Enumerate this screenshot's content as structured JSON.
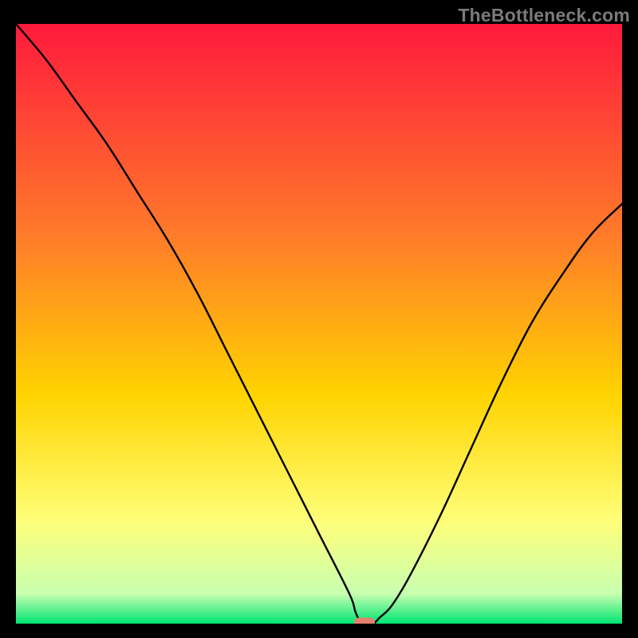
{
  "watermark": "TheBottleneck.com",
  "chart_data": {
    "type": "line",
    "title": "",
    "xlabel": "",
    "ylabel": "",
    "xlim": [
      0,
      100
    ],
    "ylim": [
      0,
      100
    ],
    "x": [
      0,
      5,
      10,
      15,
      20,
      25,
      30,
      35,
      40,
      45,
      50,
      55,
      56,
      57,
      58,
      59,
      60,
      62,
      65,
      70,
      75,
      80,
      85,
      90,
      95,
      100
    ],
    "y": [
      100,
      94,
      87,
      80,
      72,
      64,
      55,
      45,
      35,
      25,
      15,
      5,
      2,
      0,
      0,
      0,
      1,
      3,
      8,
      18,
      29,
      40,
      50,
      58,
      65,
      70
    ],
    "flat_region": {
      "x_start": 55,
      "x_end": 59,
      "y": 0
    },
    "marker": {
      "x": 57.5,
      "y": 0
    }
  },
  "colors": {
    "gradient_top": "#ff1a3c",
    "gradient_mid1": "#ff7a2a",
    "gradient_mid2": "#ffd400",
    "gradient_mid3": "#ffff7a",
    "gradient_bottom": "#00e573",
    "marker": "#e4806f",
    "curve": "#000000",
    "frame": "#000000"
  }
}
